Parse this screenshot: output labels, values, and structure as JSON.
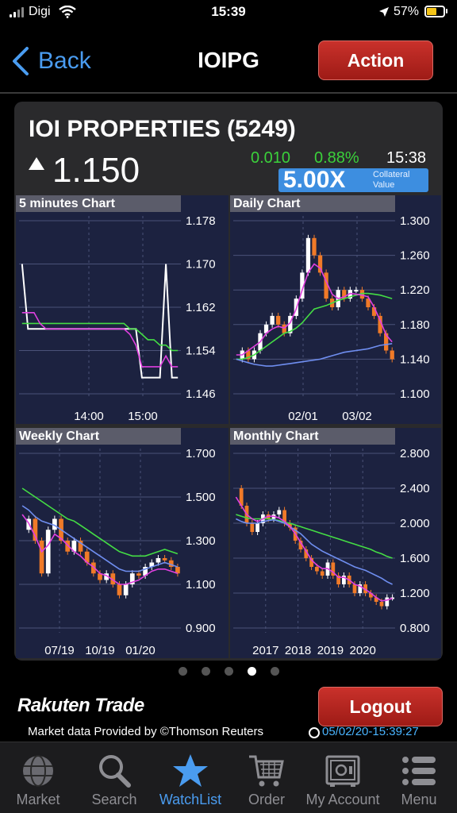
{
  "status_bar": {
    "carrier": "Digi",
    "time": "15:39",
    "battery": "57%"
  },
  "nav": {
    "back_label": "Back",
    "title": "IOIPG",
    "action_label": "Action"
  },
  "quote": {
    "name": "IOI PROPERTIES (5249)",
    "price": "1.150",
    "change": "0.010",
    "change_pct": "0.88%",
    "time": "15:38",
    "collateral_value": "5.00X",
    "collateral_label_1": "Collateral",
    "collateral_label_2": "Value",
    "up_color": "#3bd13b"
  },
  "chart_data": [
    {
      "type": "line",
      "title": "5 minutes Chart",
      "x_ticks": [
        "14:00",
        "15:00"
      ],
      "y_ticks": [
        "1.178",
        "1.170",
        "1.162",
        "1.154",
        "1.146"
      ],
      "ylim": [
        1.146,
        1.178
      ],
      "series": [
        {
          "values": [
            1.17,
            1.158,
            1.158,
            1.158,
            1.158,
            1.158,
            1.158,
            1.158,
            1.158,
            1.158,
            1.158,
            1.158,
            1.158,
            1.158,
            1.158,
            1.158,
            1.158,
            1.158,
            1.158,
            1.158,
            1.149,
            1.149,
            1.149,
            1.149,
            1.17,
            1.149,
            1.149
          ]
        },
        {
          "values": [
            1.159,
            1.159,
            1.159,
            1.159,
            1.159,
            1.159,
            1.159,
            1.159,
            1.159,
            1.159,
            1.159,
            1.159,
            1.159,
            1.159,
            1.159,
            1.159,
            1.159,
            1.159,
            1.158,
            1.158,
            1.157,
            1.156,
            1.156,
            1.155,
            1.155,
            1.154,
            1.154
          ]
        },
        {
          "values": [
            1.161,
            1.161,
            1.161,
            1.159,
            1.158,
            1.158,
            1.158,
            1.158,
            1.158,
            1.158,
            1.158,
            1.158,
            1.158,
            1.158,
            1.158,
            1.158,
            1.158,
            1.158,
            1.157,
            1.155,
            1.151,
            1.151,
            1.151,
            1.151,
            1.153,
            1.151,
            1.151
          ]
        }
      ]
    },
    {
      "type": "line",
      "title": "Daily Chart",
      "x_ticks": [
        "02/01",
        "03/02"
      ],
      "y_ticks": [
        "1.300",
        "1.260",
        "1.220",
        "1.180",
        "1.140",
        "1.100"
      ],
      "ylim": [
        1.1,
        1.3
      ],
      "series": [
        {
          "values": [
            1.14,
            1.15,
            1.14,
            1.15,
            1.17,
            1.18,
            1.19,
            1.18,
            1.17,
            1.19,
            1.21,
            1.24,
            1.28,
            1.26,
            1.24,
            1.21,
            1.2,
            1.22,
            1.21,
            1.22,
            1.22,
            1.21,
            1.2,
            1.19,
            1.17,
            1.15,
            1.14
          ]
        },
        {
          "values": [
            1.14,
            1.14,
            1.142,
            1.145,
            1.15,
            1.155,
            1.16,
            1.165,
            1.17,
            1.172,
            1.176,
            1.182,
            1.19,
            1.198,
            1.2,
            1.202,
            1.205,
            1.208,
            1.21,
            1.212,
            1.214,
            1.216,
            1.216,
            1.215,
            1.214,
            1.212,
            1.21
          ]
        },
        {
          "values": [
            1.14,
            1.138,
            1.136,
            1.134,
            1.133,
            1.132,
            1.132,
            1.133,
            1.134,
            1.135,
            1.136,
            1.137,
            1.138,
            1.139,
            1.14,
            1.142,
            1.144,
            1.146,
            1.148,
            1.149,
            1.15,
            1.151,
            1.152,
            1.154,
            1.156,
            1.157,
            1.158
          ]
        },
        {
          "values": [
            1.145,
            1.145,
            1.15,
            1.155,
            1.16,
            1.17,
            1.175,
            1.178,
            1.176,
            1.182,
            1.198,
            1.22,
            1.24,
            1.25,
            1.245,
            1.23,
            1.215,
            1.21,
            1.212,
            1.216,
            1.215,
            1.214,
            1.212,
            1.2,
            1.185,
            1.168,
            1.16
          ]
        }
      ]
    },
    {
      "type": "line",
      "title": "Weekly Chart",
      "x_ticks": [
        "07/19",
        "10/19",
        "01/20"
      ],
      "y_ticks": [
        "1.700",
        "1.500",
        "1.300",
        "1.100",
        "0.900"
      ],
      "ylim": [
        0.9,
        1.7
      ],
      "series": [
        {
          "values": [
            1.35,
            1.4,
            1.3,
            1.15,
            1.35,
            1.4,
            1.3,
            1.25,
            1.3,
            1.25,
            1.2,
            1.15,
            1.12,
            1.15,
            1.1,
            1.05,
            1.1,
            1.15,
            1.14,
            1.18,
            1.2,
            1.22,
            1.21,
            1.18,
            1.15
          ]
        },
        {
          "values": [
            1.54,
            1.52,
            1.5,
            1.48,
            1.46,
            1.44,
            1.42,
            1.4,
            1.39,
            1.37,
            1.35,
            1.33,
            1.31,
            1.29,
            1.27,
            1.25,
            1.24,
            1.23,
            1.23,
            1.23,
            1.24,
            1.25,
            1.26,
            1.25,
            1.24
          ]
        },
        {
          "values": [
            1.46,
            1.44,
            1.41,
            1.39,
            1.38,
            1.37,
            1.35,
            1.33,
            1.31,
            1.29,
            1.27,
            1.25,
            1.23,
            1.21,
            1.19,
            1.17,
            1.16,
            1.16,
            1.16,
            1.17,
            1.18,
            1.19,
            1.2,
            1.19,
            1.18
          ]
        },
        {
          "values": [
            1.42,
            1.38,
            1.32,
            1.25,
            1.28,
            1.33,
            1.31,
            1.28,
            1.25,
            1.23,
            1.2,
            1.18,
            1.15,
            1.14,
            1.12,
            1.1,
            1.1,
            1.11,
            1.12,
            1.14,
            1.16,
            1.17,
            1.17,
            1.16,
            1.15
          ]
        }
      ]
    },
    {
      "type": "line",
      "title": "Monthly Chart",
      "x_ticks": [
        "2017",
        "2018",
        "2019",
        "2020"
      ],
      "y_ticks": [
        "2.800",
        "2.400",
        "2.000",
        "1.600",
        "1.200",
        "0.800"
      ],
      "ylim": [
        0.8,
        2.8
      ],
      "series": [
        {
          "values": [
            2.4,
            2.2,
            2.0,
            1.9,
            2.0,
            2.1,
            2.05,
            2.1,
            2.15,
            2.0,
            1.95,
            1.8,
            1.7,
            1.6,
            1.5,
            1.45,
            1.4,
            1.55,
            1.4,
            1.3,
            1.4,
            1.3,
            1.2,
            1.3,
            1.2,
            1.15,
            1.1,
            1.05,
            1.15,
            1.15
          ]
        },
        {
          "values": [
            2.1,
            2.08,
            2.06,
            2.05,
            2.05,
            2.05,
            2.05,
            2.04,
            2.03,
            2.01,
            2.0,
            1.98,
            1.96,
            1.94,
            1.92,
            1.9,
            1.88,
            1.86,
            1.84,
            1.82,
            1.8,
            1.78,
            1.76,
            1.74,
            1.72,
            1.7,
            1.67,
            1.65,
            1.62,
            1.6
          ]
        },
        {
          "values": [
            2.05,
            2.02,
            2.0,
            2.0,
            2.0,
            2.02,
            2.03,
            2.04,
            2.02,
            2.0,
            1.96,
            1.92,
            1.88,
            1.82,
            1.76,
            1.72,
            1.68,
            1.65,
            1.62,
            1.59,
            1.56,
            1.53,
            1.5,
            1.48,
            1.46,
            1.43,
            1.4,
            1.37,
            1.33,
            1.3
          ]
        },
        {
          "values": [
            2.3,
            2.2,
            2.1,
            2.05,
            2.02,
            2.05,
            2.08,
            2.08,
            2.06,
            2.02,
            1.96,
            1.88,
            1.78,
            1.68,
            1.58,
            1.52,
            1.48,
            1.48,
            1.44,
            1.38,
            1.38,
            1.35,
            1.3,
            1.28,
            1.24,
            1.2,
            1.15,
            1.11,
            1.12,
            1.14
          ]
        }
      ]
    }
  ],
  "line_colors": {
    "price": "#ffffff",
    "ma1": "#e040e0",
    "ma2": "#44dd44",
    "ma3": "#6f8ef0",
    "candle_up": "#ffffff",
    "candle_down": "#f07a28"
  },
  "pager": {
    "count": 5,
    "active_index": 3
  },
  "footer": {
    "logo": "Rakuten Trade",
    "logout_label": "Logout",
    "provider": "Market data Provided by ©Thomson Reuters",
    "timestamp": "05/02/20-15:39:27"
  },
  "tabs": [
    {
      "label": "Market",
      "icon": "globe-icon"
    },
    {
      "label": "Search",
      "icon": "search-icon"
    },
    {
      "label": "WatchList",
      "icon": "star-icon",
      "active": true
    },
    {
      "label": "Order",
      "icon": "cart-icon"
    },
    {
      "label": "My Account",
      "icon": "safe-icon"
    },
    {
      "label": "Menu",
      "icon": "menu-icon"
    }
  ]
}
